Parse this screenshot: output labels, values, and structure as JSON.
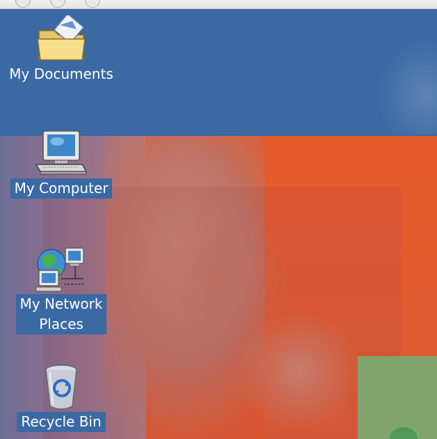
{
  "desktop": {
    "icons": [
      {
        "label": "My Documents",
        "icon": "folder-icon"
      },
      {
        "label": "My Computer",
        "icon": "computer-icon"
      },
      {
        "label": "My Network\nPlaces",
        "icon": "network-icon"
      },
      {
        "label": "Recycle Bin",
        "icon": "recycle-bin-icon"
      }
    ]
  },
  "colors": {
    "selection_bg": "#3a69a4",
    "label_text": "#ffffff"
  }
}
